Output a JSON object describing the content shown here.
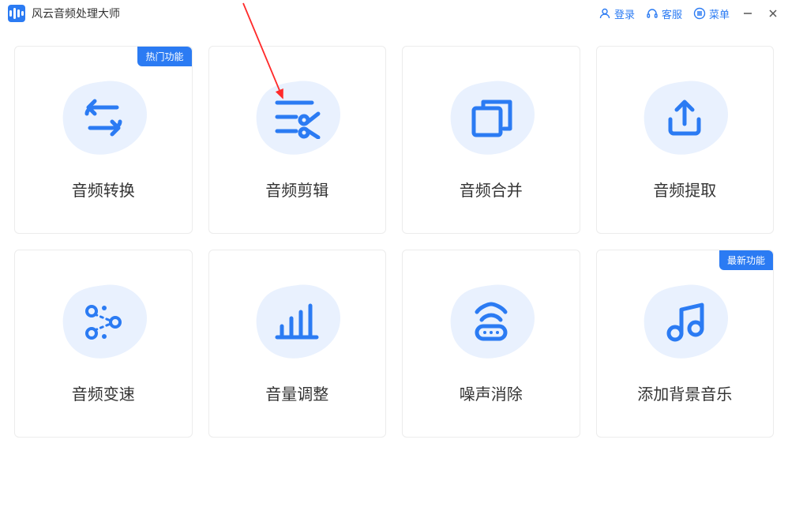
{
  "app": {
    "title": "风云音频处理大师"
  },
  "header": {
    "login": "登录",
    "service": "客服",
    "menu": "菜单"
  },
  "badges": {
    "hot": "热门功能",
    "new": "最新功能"
  },
  "cards": [
    {
      "id": "convert",
      "label": "音频转换",
      "icon": "swap-icon",
      "badge": "hot"
    },
    {
      "id": "clip",
      "label": "音频剪辑",
      "icon": "cut-icon"
    },
    {
      "id": "merge",
      "label": "音频合并",
      "icon": "merge-icon"
    },
    {
      "id": "extract",
      "label": "音频提取",
      "icon": "extract-icon"
    },
    {
      "id": "speed",
      "label": "音频变速",
      "icon": "speed-icon"
    },
    {
      "id": "volume",
      "label": "音量调整",
      "icon": "volume-icon"
    },
    {
      "id": "denoise",
      "label": "噪声消除",
      "icon": "denoise-icon"
    },
    {
      "id": "bgmusic",
      "label": "添加背景音乐",
      "icon": "music-icon",
      "badge": "new"
    }
  ],
  "colors": {
    "accent": "#2b7bf3",
    "blob": "#e9f1fe"
  }
}
